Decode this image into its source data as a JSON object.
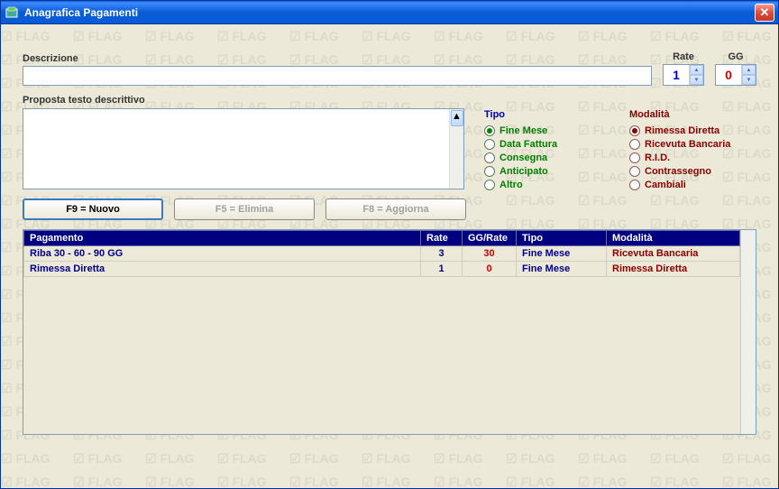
{
  "titlebar": {
    "title": "Anagrafica Pagamenti"
  },
  "fields": {
    "descrizione_label": "Descrizione",
    "descrizione_value": "",
    "rate_label": "Rate",
    "rate_value": "1",
    "gg_label": "GG",
    "gg_value": "0",
    "proposta_label": "Proposta testo descrittivo",
    "proposta_value": ""
  },
  "tipo": {
    "title": "Tipo",
    "options": [
      {
        "label": "Fine Mese",
        "checked": true
      },
      {
        "label": "Data Fattura",
        "checked": false
      },
      {
        "label": "Consegna",
        "checked": false
      },
      {
        "label": "Anticipato",
        "checked": false
      },
      {
        "label": "Altro",
        "checked": false
      }
    ]
  },
  "modalita": {
    "title": "Modalità",
    "options": [
      {
        "label": "Rimessa Diretta",
        "checked": true
      },
      {
        "label": "Ricevuta Bancaria",
        "checked": false
      },
      {
        "label": "R.I.D.",
        "checked": false
      },
      {
        "label": "Contrassegno",
        "checked": false
      },
      {
        "label": "Cambiali",
        "checked": false
      }
    ]
  },
  "buttons": {
    "nuovo": "F9 = Nuovo",
    "elimina": "F5 = Elimina",
    "aggiorna": "F8 = Aggiorna"
  },
  "grid": {
    "headers": {
      "pagamento": "Pagamento",
      "rate": "Rate",
      "ggrate": "GG/Rate",
      "tipo": "Tipo",
      "modalita": "Modalità"
    },
    "rows": [
      {
        "pagamento": "Riba 30 - 60 - 90 GG",
        "rate": "3",
        "ggrate": "30",
        "tipo": "Fine Mese",
        "modalita": "Ricevuta Bancaria"
      },
      {
        "pagamento": "Rimessa Diretta",
        "rate": "1",
        "ggrate": "0",
        "tipo": "Fine Mese",
        "modalita": "Rimessa Diretta"
      }
    ]
  }
}
